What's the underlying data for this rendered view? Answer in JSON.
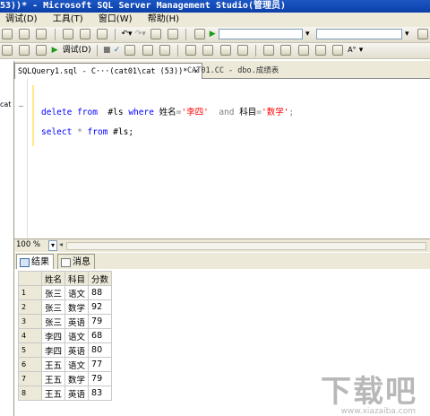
{
  "window": {
    "title": "53))* - Microsoft SQL Server Management Studio(管理员)"
  },
  "menubar": {
    "items": [
      "调试(D)",
      "工具(T)",
      "窗口(W)",
      "帮助(H)"
    ]
  },
  "toolbar2": {
    "debug_label": "调试(D)"
  },
  "editor_tabs": [
    {
      "label": "SQLQuery1.sql - C···(cat01\\cat (53))*",
      "close": "×"
    },
    {
      "label": "CAT01.CC - dbo.成绩表"
    }
  ],
  "leftpane": {
    "text": "cat"
  },
  "editor": {
    "line1": {
      "kw1": "delete",
      "kw2": "from",
      "table": "#ls",
      "kw3": "where",
      "col1": "姓名",
      "op1": "=",
      "val1": "'李四'",
      "kw4": "and",
      "col2": "科目",
      "op2": "=",
      "val2": "'数学'",
      "end": ";"
    },
    "line2": {
      "kw1": "select",
      "star": "*",
      "kw2": "from",
      "table": "#ls;"
    }
  },
  "zoom": {
    "value": "100 %"
  },
  "result_tabs": {
    "results": "结果",
    "messages": "消息"
  },
  "results": {
    "columns": [
      "姓名",
      "科目",
      "分数"
    ],
    "rows": [
      [
        "1",
        "张三",
        "语文",
        "88"
      ],
      [
        "2",
        "张三",
        "数学",
        "92"
      ],
      [
        "3",
        "张三",
        "英语",
        "79"
      ],
      [
        "4",
        "李四",
        "语文",
        "68"
      ],
      [
        "5",
        "李四",
        "英语",
        "80"
      ],
      [
        "6",
        "王五",
        "语文",
        "77"
      ],
      [
        "7",
        "王五",
        "数学",
        "79"
      ],
      [
        "8",
        "王五",
        "英语",
        "83"
      ]
    ]
  },
  "watermark": {
    "main": "下载吧",
    "sub": "www.xiazaiba.com"
  },
  "colors": {
    "title_blue": "#0b3fa8",
    "keyword_blue": "#0000ff",
    "string_red": "#ff0000",
    "chrome": "#ece9d8"
  }
}
